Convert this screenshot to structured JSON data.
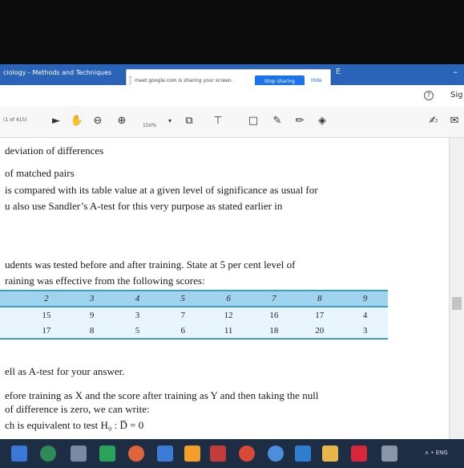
{
  "window": {
    "app_title": "ciology - Methods and Techniques",
    "title_letter": "E",
    "minimize_symbol": "–"
  },
  "share_popup": {
    "message": "meet.google.com is sharing your screen.",
    "stop_button": "Stop sharing",
    "hide_link": "Hide"
  },
  "tab_row": {
    "help_symbol": "?",
    "signin_label": "Sig"
  },
  "toolbar": {
    "page_indicator": "(1 of 415)",
    "zoom_value": "150%"
  },
  "document": {
    "line_1": "deviation of differences",
    "line_2": "of matched pairs",
    "line_3": "is compared with its table value at a given level of significance as usual for",
    "line_4": "u also use Sandler’s A-test for this very purpose as stated earlier in",
    "line_5": "udents was tested before and after training. State at 5 per cent level of",
    "line_6": "raining was effective from the following scores:",
    "line_7": "ell as A-test for your answer.",
    "line_8": "efore training as X and the score after training as Y and then taking the null",
    "line_9": "of difference is zero, we can write:",
    "line_10": "ch is equivalent to test H₀ : D̅ = 0",
    "table": {
      "header": [
        "2",
        "3",
        "4",
        "5",
        "6",
        "7",
        "8",
        "9"
      ],
      "row_1": [
        "15",
        "9",
        "3",
        "7",
        "12",
        "16",
        "17",
        "4"
      ],
      "row_2": [
        "17",
        "8",
        "5",
        "6",
        "11",
        "18",
        "20",
        "3"
      ]
    }
  },
  "colors": {
    "title_bar": "#2a64b8",
    "table_header": "#9fd3ee",
    "table_rule": "#3c9ed0",
    "share_button": "#1a73e8",
    "taskbar": "#1d2d44"
  },
  "taskbar": {
    "tray_text": "∧ • ENG"
  }
}
